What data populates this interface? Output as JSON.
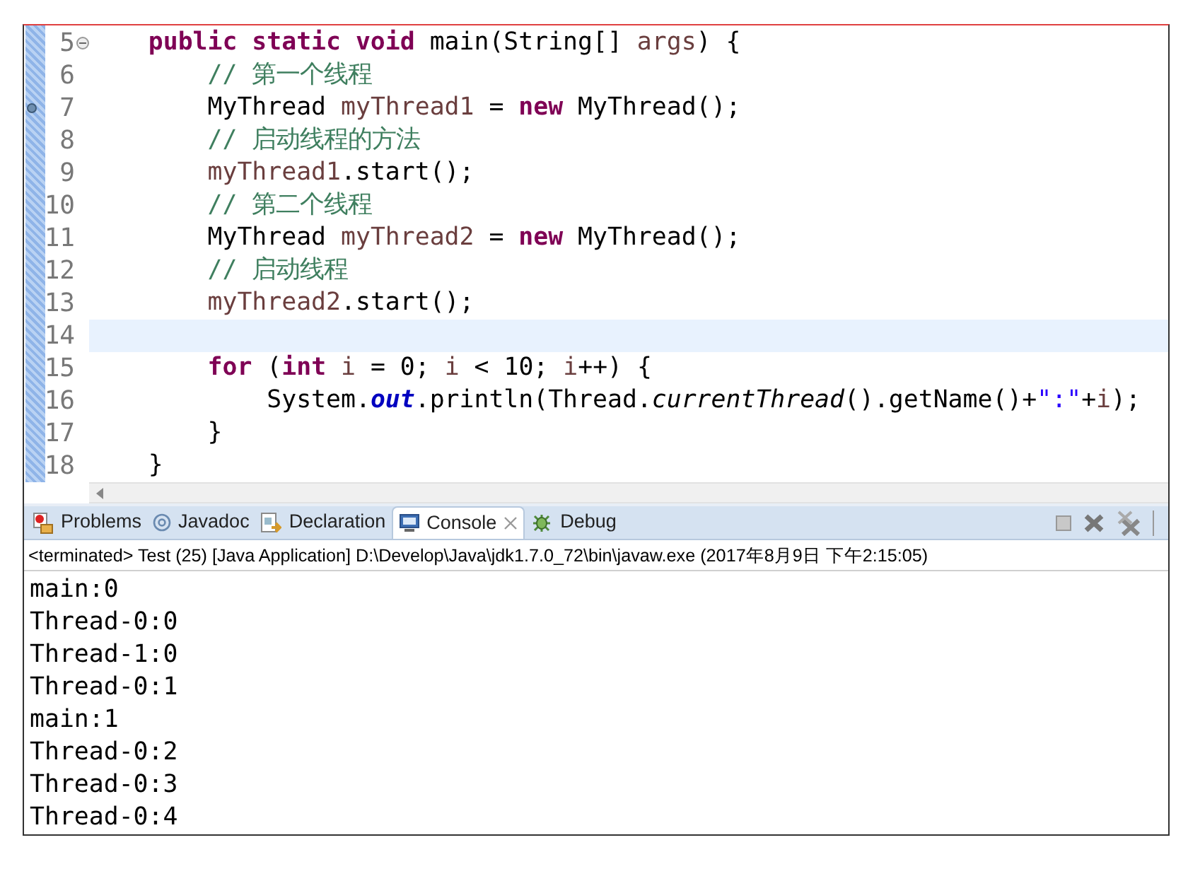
{
  "editor": {
    "lines": [
      {
        "number": "5",
        "expanded": true,
        "marked": false,
        "current": false,
        "tokens": [
          {
            "kind": "keyword",
            "text": "    public static void"
          },
          {
            "kind": "plain",
            "text": " main(String[] "
          },
          {
            "kind": "variable",
            "text": "args"
          },
          {
            "kind": "plain",
            "text": ") {"
          }
        ]
      },
      {
        "number": "6",
        "marked": false,
        "current": false,
        "tokens": [
          {
            "kind": "comment",
            "text": "        // 第一个线程"
          }
        ]
      },
      {
        "number": "7",
        "marked": true,
        "current": false,
        "tokens": [
          {
            "kind": "plain",
            "text": "        MyThread "
          },
          {
            "kind": "variable",
            "text": "myThread1"
          },
          {
            "kind": "plain",
            "text": " = "
          },
          {
            "kind": "keyword",
            "text": "new"
          },
          {
            "kind": "plain",
            "text": " MyThread();"
          }
        ]
      },
      {
        "number": "8",
        "marked": false,
        "current": false,
        "tokens": [
          {
            "kind": "comment",
            "text": "        // 启动线程的方法"
          }
        ]
      },
      {
        "number": "9",
        "marked": false,
        "current": false,
        "tokens": [
          {
            "kind": "variable",
            "text": "        myThread1"
          },
          {
            "kind": "plain",
            "text": ".start();"
          }
        ]
      },
      {
        "number": "10",
        "marked": false,
        "current": false,
        "tokens": [
          {
            "kind": "comment",
            "text": "        // 第二个线程"
          }
        ]
      },
      {
        "number": "11",
        "marked": false,
        "current": false,
        "tokens": [
          {
            "kind": "plain",
            "text": "        MyThread "
          },
          {
            "kind": "variable",
            "text": "myThread2"
          },
          {
            "kind": "plain",
            "text": " = "
          },
          {
            "kind": "keyword",
            "text": "new"
          },
          {
            "kind": "plain",
            "text": " MyThread();"
          }
        ]
      },
      {
        "number": "12",
        "marked": false,
        "current": false,
        "tokens": [
          {
            "kind": "comment",
            "text": "        // 启动线程"
          }
        ]
      },
      {
        "number": "13",
        "marked": false,
        "current": false,
        "tokens": [
          {
            "kind": "variable",
            "text": "        myThread2"
          },
          {
            "kind": "plain",
            "text": ".start();"
          }
        ]
      },
      {
        "number": "14",
        "marked": false,
        "current": true
      },
      {
        "number": "15",
        "marked": false,
        "current": false,
        "tokens": [
          {
            "kind": "keyword",
            "text": "        for"
          },
          {
            "kind": "plain",
            "text": " ("
          },
          {
            "kind": "keyword",
            "text": "int "
          },
          {
            "kind": "variable",
            "text": "i"
          },
          {
            "kind": "plain",
            "text": " = 0; "
          },
          {
            "kind": "variable",
            "text": "i"
          },
          {
            "kind": "plain",
            "text": " < 10; "
          },
          {
            "kind": "variable",
            "text": "i"
          },
          {
            "kind": "plain",
            "text": "++) {"
          }
        ]
      },
      {
        "number": "16",
        "marked": false,
        "current": false,
        "tokens": [
          {
            "kind": "plain",
            "text": "            System."
          },
          {
            "kind": "field",
            "text": "out"
          },
          {
            "kind": "plain",
            "text": ".println(Thread."
          },
          {
            "kind": "static_method",
            "text": "currentThread"
          },
          {
            "kind": "plain",
            "text": "().getName()+"
          },
          {
            "kind": "string",
            "text": "\":\""
          },
          {
            "kind": "plain",
            "text": "+"
          },
          {
            "kind": "variable",
            "text": "i"
          },
          {
            "kind": "plain",
            "text": ");"
          }
        ]
      },
      {
        "number": "17",
        "marked": false,
        "current": false,
        "tokens": [
          {
            "kind": "plain",
            "text": "        }"
          }
        ]
      },
      {
        "number": "18",
        "marked": false,
        "current": false,
        "tokens": [
          {
            "kind": "plain",
            "text": "    }"
          }
        ]
      }
    ]
  },
  "panel": {
    "tabs": [
      {
        "label": "Problems",
        "selected": false
      },
      {
        "label": "Javadoc",
        "selected": false
      },
      {
        "label": "Declaration",
        "selected": false
      },
      {
        "label": "Console",
        "selected": true
      },
      {
        "label": "Debug",
        "selected": false
      }
    ],
    "status": "<terminated> Test (25) [Java Application] D:\\Develop\\Java\\jdk1.7.0_72\\bin\\javaw.exe (2017年8月9日 下午2:15:05)",
    "output": [
      "main:0",
      "Thread-0:0",
      "Thread-1:0",
      "Thread-0:1",
      "main:1",
      "Thread-0:2",
      "Thread-0:3",
      "Thread-0:4"
    ]
  }
}
